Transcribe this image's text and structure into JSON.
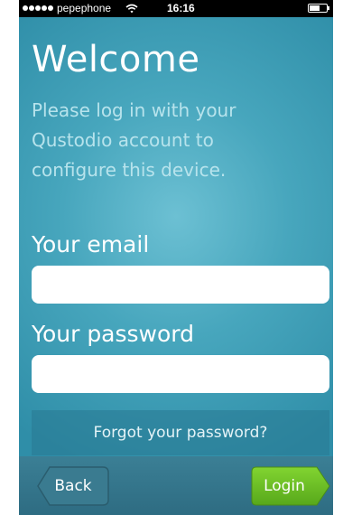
{
  "status_bar": {
    "carrier": "pepephone",
    "time": "16:16",
    "signal_bars": 5,
    "wifi_icon": "wifi-icon",
    "battery_icon": "battery-icon"
  },
  "title": "Welcome",
  "instructions": "Please log in with your Qustodio account to configure this device.",
  "email_field": {
    "label": "Your email",
    "value": "",
    "placeholder": ""
  },
  "password_field": {
    "label": "Your password",
    "value": "",
    "placeholder": ""
  },
  "forgot_password_label": "Forgot your password?",
  "toolbar": {
    "back_label": "Back",
    "login_label": "Login"
  },
  "colors": {
    "background": "#47a6bd",
    "login_button": "#6cbe22",
    "status_bar": "#000000"
  }
}
